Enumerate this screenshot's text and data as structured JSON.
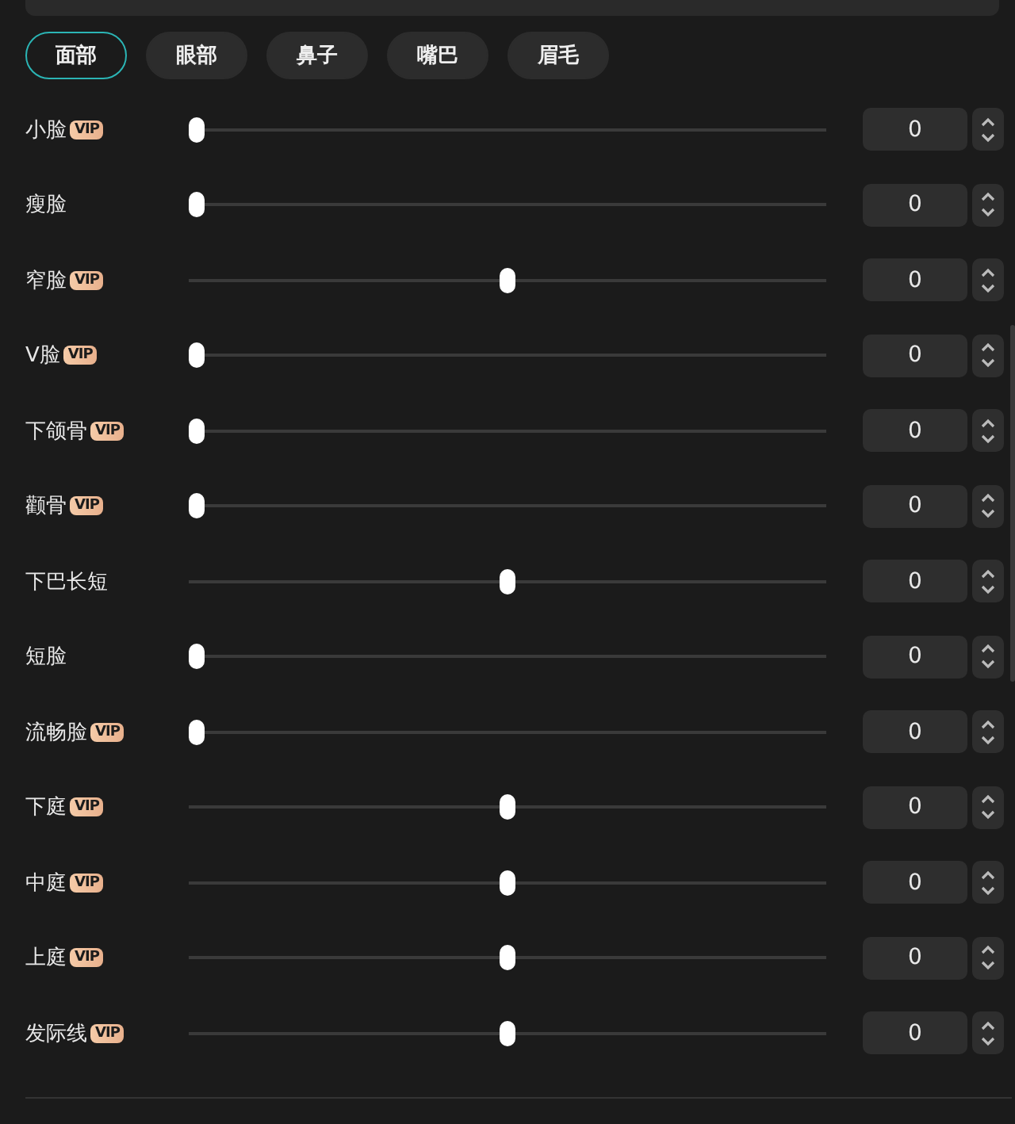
{
  "tabs": [
    {
      "label": "面部",
      "selected": true
    },
    {
      "label": "眼部",
      "selected": false
    },
    {
      "label": "鼻子",
      "selected": false
    },
    {
      "label": "嘴巴",
      "selected": false
    },
    {
      "label": "眉毛",
      "selected": false
    }
  ],
  "sliders": [
    {
      "label": "小脸",
      "badge": "VIP",
      "level": 0,
      "value": "0"
    },
    {
      "label": "瘦脸",
      "level": 0,
      "value": "0"
    },
    {
      "label": "窄脸",
      "badge": "VIP",
      "level": 0.5,
      "value": "0"
    },
    {
      "label": "V脸",
      "badge": "VIP",
      "level": 0,
      "value": "0"
    },
    {
      "label": "下颌骨",
      "badge": "VIP",
      "level": 0,
      "value": "0"
    },
    {
      "label": "颧骨",
      "badge": "VIP",
      "level": 0,
      "value": "0"
    },
    {
      "label": "下巴长短",
      "level": 0.5,
      "value": "0"
    },
    {
      "label": "短脸",
      "level": 0,
      "value": "0"
    },
    {
      "label": "流畅脸",
      "badge": "VIP",
      "level": 0,
      "value": "0"
    },
    {
      "label": "下庭",
      "badge": "VIP",
      "level": 0.5,
      "value": "0"
    },
    {
      "label": "中庭",
      "badge": "VIP",
      "level": 0.5,
      "value": "0"
    },
    {
      "label": "上庭",
      "badge": "VIP",
      "level": 0.5,
      "value": "0"
    },
    {
      "label": "发际线",
      "badge": "VIP",
      "level": 0.5,
      "value": "0"
    }
  ]
}
